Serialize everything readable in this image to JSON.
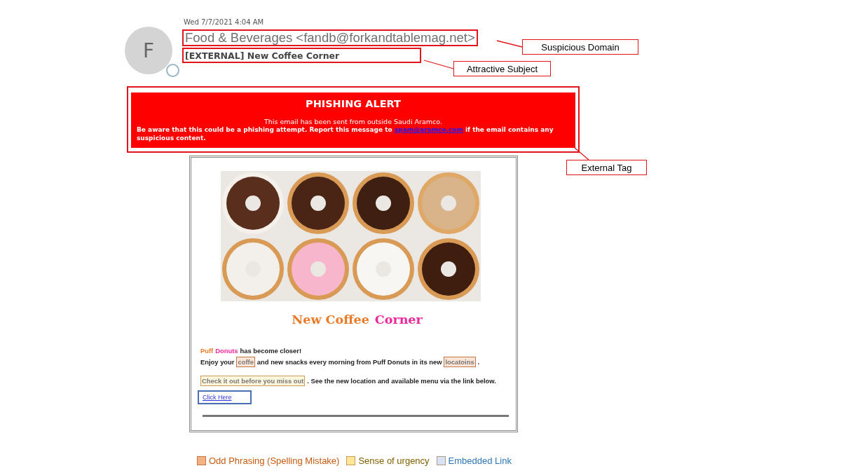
{
  "email": {
    "avatar_letter": "F",
    "date": "Wed 7/7/2021 4:04 AM",
    "sender": "Food & Beverages <fandb@forkandtablemag.net>",
    "subject": "[EXTERNAL] New Coffee Corner"
  },
  "alert": {
    "title": "PHISHING ALERT",
    "line1": "This email has been sent from outside Saudi Aramco.",
    "line2_before": "Be aware that this could be a phishing attempt. Report this message to",
    "link": "spam@aramco.com",
    "line2_after": "if the email contains any suspicious content."
  },
  "body": {
    "headline": [
      {
        "text": "New Coffee",
        "color": "#ea7a28"
      },
      {
        "text": "Corner",
        "color": "#f0279a"
      }
    ],
    "lines": [
      [
        {
          "kind": "plain",
          "text": "Puff",
          "color": "#ea7a28"
        },
        {
          "kind": "plain",
          "text": "Donuts",
          "color": "#f0279a"
        },
        {
          "kind": "plain",
          "text": "has become closer!"
        }
      ],
      [
        {
          "kind": "plain",
          "text": "Enjoy your"
        },
        {
          "kind": "spelling",
          "text": "coffe"
        },
        {
          "kind": "plain",
          "text": "and new snacks every morning from Puff Donuts in its new"
        },
        {
          "kind": "spelling",
          "text": "locatoins"
        },
        {
          "kind": "plain",
          "text": "."
        }
      ],
      [
        {
          "kind": "urgency",
          "text": "Check it out before you miss out"
        },
        {
          "kind": "plain",
          "text": ". See the new location and available menu via the link below."
        }
      ]
    ],
    "link": {
      "kind": "link",
      "text": "Click Here"
    }
  },
  "callouts": [
    {
      "label": "Suspicious Domain"
    },
    {
      "label": "Attractive Subject"
    },
    {
      "label": "External Tag"
    }
  ],
  "legend": [
    {
      "kind": "spelling",
      "label": "Odd Phrasing (Spelling Mistake)",
      "color": "#f4b183"
    },
    {
      "kind": "urgency",
      "label": "Sense of urgency",
      "color": "#ffe699"
    },
    {
      "kind": "link",
      "label": "Embedded Link",
      "color": "#dae3f3"
    }
  ]
}
